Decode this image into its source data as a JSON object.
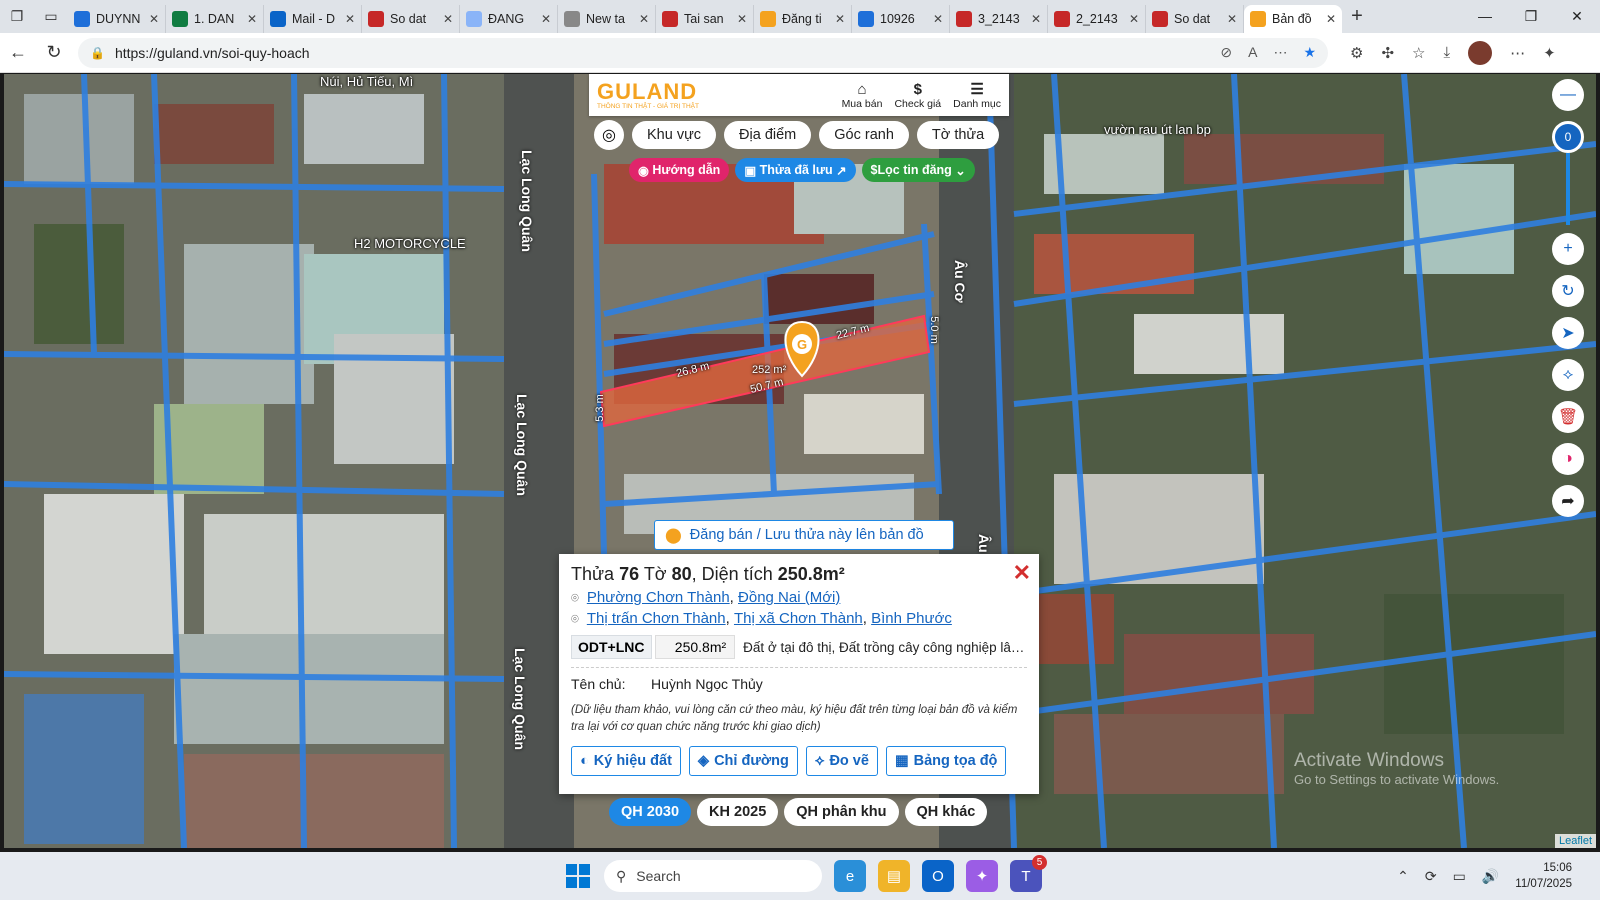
{
  "browser": {
    "tabs": [
      {
        "title": "DUYNN",
        "color": "#1e6fd9"
      },
      {
        "title": "1. DAN",
        "color": "#107c41"
      },
      {
        "title": "Mail - D",
        "color": "#0a64c8"
      },
      {
        "title": "So dat",
        "color": "#c62828"
      },
      {
        "title": "ĐANG",
        "color": "#8ab4f8"
      },
      {
        "title": "New ta",
        "color": "#888888"
      },
      {
        "title": "Tai san",
        "color": "#c62828"
      },
      {
        "title": "Đăng ti",
        "color": "#f4a21f"
      },
      {
        "title": "10926",
        "color": "#1e6fd9"
      },
      {
        "title": "3_2143",
        "color": "#c62828"
      },
      {
        "title": "2_2143",
        "color": "#c62828"
      },
      {
        "title": "So dat",
        "color": "#c62828"
      },
      {
        "title": "Bản đồ",
        "color": "#f4a21f"
      }
    ],
    "url": "https://guland.vn/soi-quy-hoach"
  },
  "map": {
    "labels": {
      "top_place": "Núi, Hủ Tiếu, Mì",
      "motorcycle": "H2 MOTORCYCLE",
      "vuon": "vườn rau út lan bp"
    },
    "roads": {
      "lac_long_quan": "Lạc Long Quân",
      "au_co": "Âu Cơ",
      "au_co_partial": "Âu"
    },
    "dimensions": {
      "d1": "22.7 m",
      "d2": "26.8 m",
      "d3": "252 m²",
      "d4": "50.7 m",
      "d5": "5.0 m",
      "d6": "5.3 m"
    },
    "leaflet": "Leaflet"
  },
  "guland": {
    "logo": "GULAND",
    "tagline": "THÔNG TIN THẬT - GIÁ TRỊ THẬT",
    "menu": [
      {
        "icon": "⌂",
        "label": "Mua bán"
      },
      {
        "icon": "$",
        "label": "Check giá"
      },
      {
        "icon": "☰",
        "label": "Danh mục"
      }
    ],
    "pills": [
      "Khu vực",
      "Địa điểm",
      "Góc ranh",
      "Tờ thửa"
    ],
    "chips": {
      "huong_dan": "Hướng dẫn",
      "thua_luu": "Thửa đã lưu",
      "loc_tin": "Lọc tin đăng"
    },
    "zoom": "0"
  },
  "dangban": "Đăng bán / Lưu thửa này lên bản đồ",
  "popup": {
    "title_prefix": "Thửa",
    "thua": "76",
    "to_label": "Tờ",
    "to": "80",
    "area_label": ", Diện tích",
    "area": "250.8m²",
    "addr1": [
      "Phường Chơn Thành",
      "Đồng Nai (Mới)"
    ],
    "addr2": [
      "Thị trấn Chơn Thành",
      "Thị xã Chơn Thành",
      "Bình Phước"
    ],
    "land_code": "ODT+LNC",
    "land_area": "250.8m²",
    "land_desc": "Đất ở tại đô thị, Đất trồng cây công nghiệp lâu...",
    "owner_label": "Tên chủ:",
    "owner": "Huỳnh Ngọc Thủy",
    "note": "(Dữ liệu tham khảo, vui lòng căn cứ theo màu, ký hiệu đất trên từng loại bản đồ và kiểm tra lại với cơ quan chức năng trước khi giao dịch)",
    "buttons": [
      "Ký hiệu đất",
      "Chỉ đường",
      "Đo vẽ",
      "Bảng tọa độ"
    ]
  },
  "qh": [
    "QH 2030",
    "KH 2025",
    "QH phân khu",
    "QH khác"
  ],
  "watermark": {
    "line1": "Activate Windows",
    "line2": "Go to Settings to activate Windows."
  },
  "taskbar": {
    "search": "Search",
    "badge": "5",
    "time": "15:06",
    "date": "11/07/2025"
  }
}
